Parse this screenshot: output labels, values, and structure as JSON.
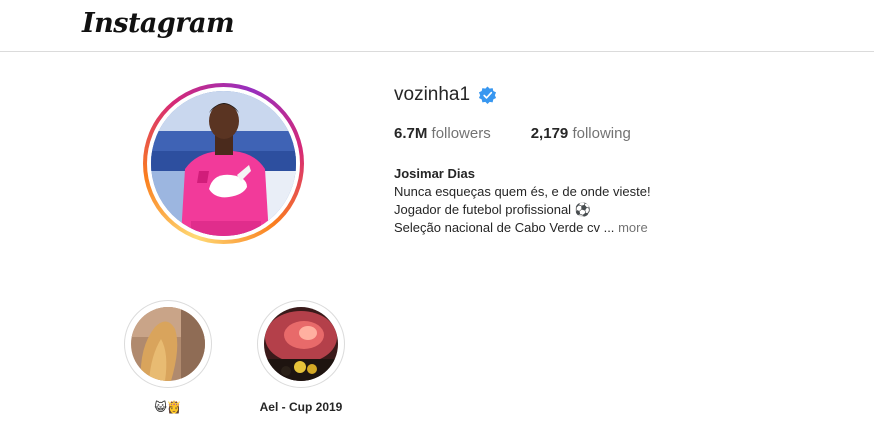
{
  "brand": {
    "logo_text": "Instagram"
  },
  "profile": {
    "username": "vozinha1",
    "verified": true,
    "followers_count": "6.7M",
    "followers_label": "followers",
    "following_count": "2,179",
    "following_label": "following",
    "display_name": "Josimar Dias",
    "bio_lines": [
      "Nunca esqueças quem és, e de onde vieste!",
      "Jogador de futebol profissional ⚽",
      "Seleção nacional de Cabo Verde cv ..."
    ],
    "more_label": "more"
  },
  "highlights": [
    {
      "label": "😺👸"
    },
    {
      "label": "Ael - Cup 2019"
    }
  ],
  "colors": {
    "verified_blue": "#3897f0",
    "secondary_text": "#737373",
    "divider": "#dbdbdb"
  }
}
